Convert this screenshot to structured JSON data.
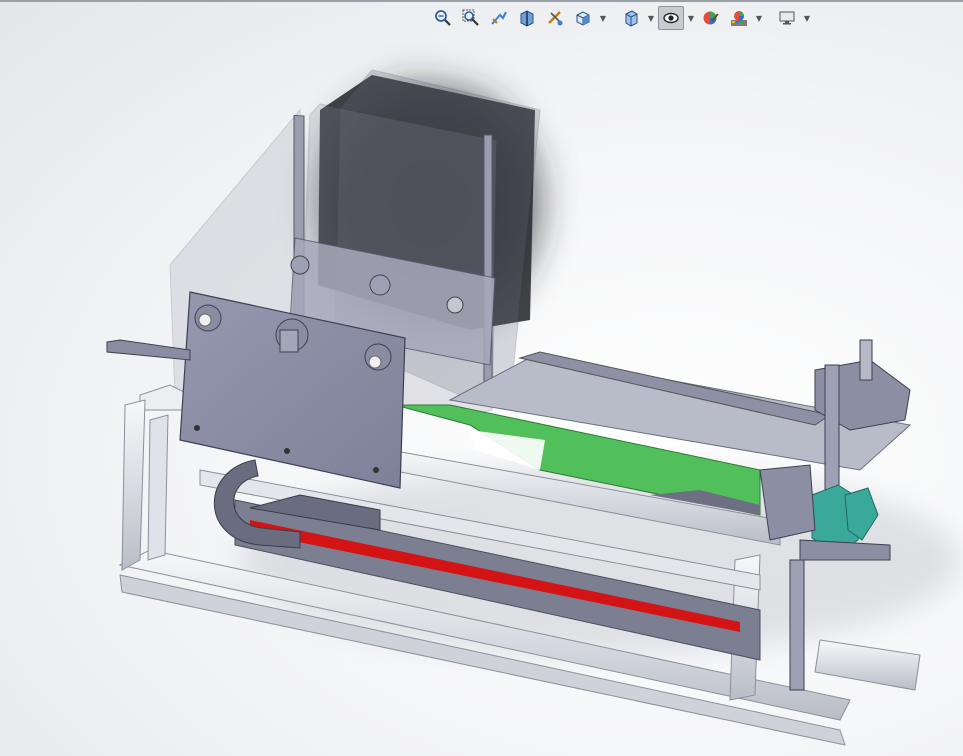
{
  "window": {
    "title": ""
  },
  "toolbar": {
    "buttons": [
      {
        "name": "zoom-to-fit-icon"
      },
      {
        "name": "zoom-to-area-icon"
      },
      {
        "name": "previous-view-icon"
      },
      {
        "name": "section-view-icon"
      },
      {
        "name": "dynamic-annotation-icon"
      },
      {
        "name": "view-orientation-icon",
        "dropdown": true
      },
      {
        "name": "display-style-icon",
        "dropdown": true
      },
      {
        "name": "hide-show-items-icon",
        "dropdown": true,
        "active": true
      },
      {
        "name": "edit-appearance-icon"
      },
      {
        "name": "apply-scene-icon",
        "dropdown": true
      },
      {
        "name": "view-settings-icon",
        "dropdown": true
      }
    ]
  },
  "colors": {
    "frame_aluminum": "#e8eaee",
    "plate_steel": "#8b8ea6",
    "belt_green": "#52c05a",
    "rail_red": "#d41414",
    "nozzle_teal": "#3aa89a",
    "dark_panel": "#2e2f33"
  }
}
